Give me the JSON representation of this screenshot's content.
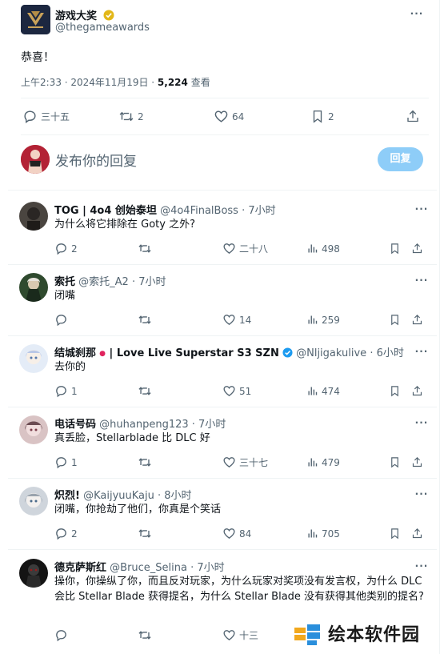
{
  "post": {
    "author_name": "游戏大奖",
    "author_handle": "@thegameawards",
    "text": "恭喜！",
    "time": "上午2:33 · 2024年11月19日 · ",
    "views_count": "5,224",
    "views_label": " 查看",
    "actions": {
      "reply_count": "三十五",
      "retweet_count": "2",
      "like_count": "64",
      "bookmark_count": "2"
    }
  },
  "composer": {
    "placeholder": "发布你的回复",
    "reply_button": "回复"
  },
  "replies": [
    {
      "name": "TOG | 4o4 创始泰坦",
      "handle": "@4o4FinalBoss",
      "time": "· 7小时",
      "text": "为什么将它排除在 Goty 之外?",
      "reply_count": "2",
      "like_count": "二十八",
      "view_count": "498"
    },
    {
      "name": "索托",
      "handle": "@索托_A2",
      "time": "· 7小时",
      "text": "闭嘴",
      "reply_count": "",
      "like_count": "14",
      "view_count": "259"
    },
    {
      "name": "结城刹那",
      "name_suffix": " | Love Live Superstar S3 SZN",
      "handle": "@Nljigakulive",
      "time": "· 6小时",
      "text": "去你的",
      "reply_count": "1",
      "like_count": "51",
      "view_count": "474"
    },
    {
      "name": "电话号码",
      "handle": "@huhanpeng123",
      "time": "· 7小时",
      "text": "真丢脸，Stellarblade 比 DLC 好",
      "reply_count": "1",
      "like_count": "三十七",
      "view_count": "479"
    },
    {
      "name": "炽烈!",
      "handle": "@KaijyuuKaju",
      "time": "· 8小时",
      "text": "闭嘴，你抢劫了他们，你真是个笑话",
      "reply_count": "2",
      "like_count": "84",
      "view_count": "705"
    },
    {
      "name": "德克萨斯红",
      "handle": "@Bruce_Selina",
      "time": "· 7小时",
      "text": "操你，你操纵了你，而且反对玩家，为什么玩家对奖项没有发言权，为什么 DLC 会比 Stellar Blade 获得提名，为什么 Stellar Blade 没有获得其他类别的提名?",
      "reply_count": "",
      "like_count": "十三",
      "view_count": ""
    }
  ],
  "watermark": {
    "text": "绘本软件园"
  },
  "colors": {
    "primary_text": "#0f1419",
    "secondary_text": "#536471",
    "reply_button": "#8ecdf8",
    "verified_gold": "#e2b719",
    "verified_blue": "#1d9bf0"
  }
}
